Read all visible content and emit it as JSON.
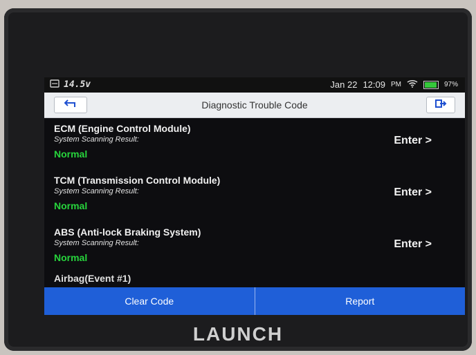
{
  "status_bar": {
    "voltage": "14.5v",
    "date": "Jan 22",
    "time": "12:09",
    "ampm": "PM",
    "battery_percent_text": "97%",
    "battery_level": 0.97,
    "icons": [
      "dashboard-icon",
      "wifi-icon",
      "battery-icon"
    ]
  },
  "header": {
    "title": "Diagnostic Trouble Code",
    "back_icon": "back-arrow-icon",
    "exit_icon": "exit-icon"
  },
  "modules": [
    {
      "name": "ECM (Engine Control Module)",
      "result_label": "System Scanning Result:",
      "status": "Normal",
      "action": "Enter >"
    },
    {
      "name": "TCM (Transmission Control Module)",
      "result_label": "System Scanning Result:",
      "status": "Normal",
      "action": "Enter >"
    },
    {
      "name": "ABS (Anti-lock Braking System)",
      "result_label": "System Scanning Result:",
      "status": "Normal",
      "action": "Enter >"
    }
  ],
  "partial_item": "Airbag(Event #1)",
  "footer": {
    "clear_code": "Clear Code",
    "report": "Report"
  },
  "brand": "LAUNCH",
  "colors": {
    "accent": "#1f5fd8",
    "normal_status": "#27d43c",
    "header_bg": "#eceef1",
    "screen_bg": "#0d0d10"
  }
}
